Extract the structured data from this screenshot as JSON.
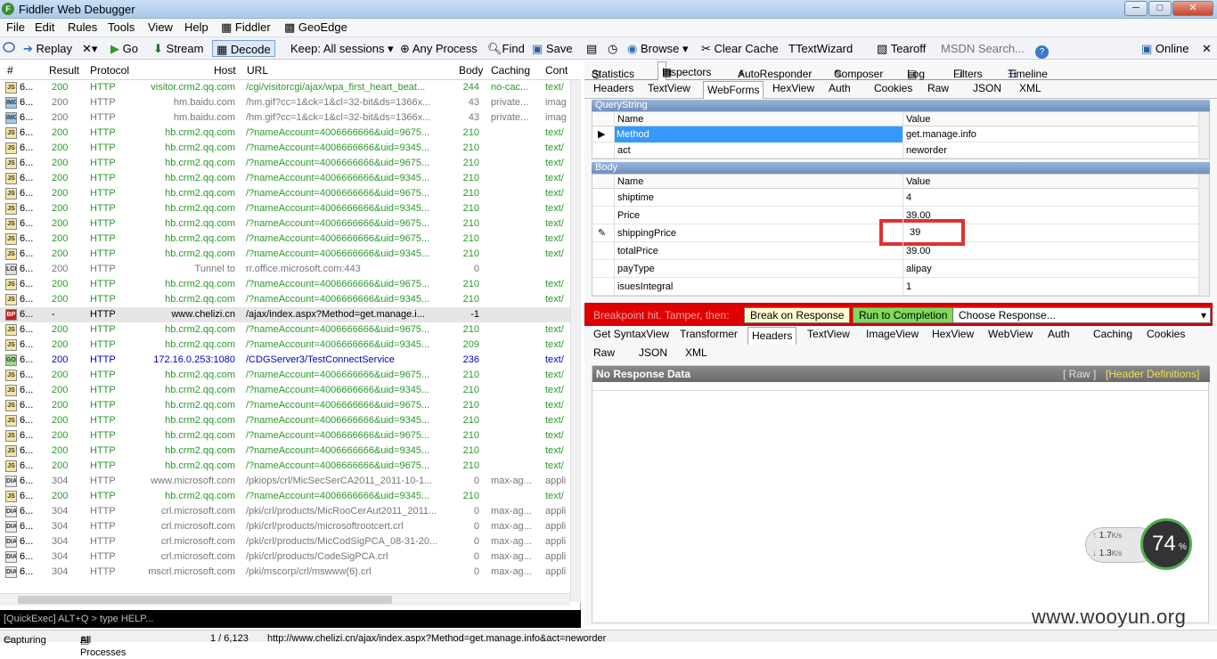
{
  "window": {
    "title": "Fiddler Web Debugger",
    "minimize": "─",
    "maximize": "□",
    "close": "✕"
  },
  "menu": [
    "File",
    "Edit",
    "Rules",
    "Tools",
    "View",
    "Help",
    "Fiddler",
    "GeoEdge"
  ],
  "toolbar": {
    "replay": "Replay",
    "go": "Go",
    "stream": "Stream",
    "decode": "Decode",
    "keep": "Keep: All sessions",
    "process": "Any Process",
    "find": "Find",
    "save": "Save",
    "browse": "Browse",
    "clearcache": "Clear Cache",
    "textwizard": "TextWizard",
    "tearoff": "Tearoff",
    "msdn_placeholder": "MSDN Search...",
    "online": "Online"
  },
  "grid": {
    "columns": [
      "#",
      "Result",
      "Protocol",
      "Host",
      "URL",
      "Body",
      "Caching",
      "Cont"
    ],
    "rows": [
      {
        "id": "6...",
        "result": "200",
        "proto": "HTTP",
        "host": "visitor.crm2.qq.com",
        "url": "/cgi/visitorcgi/ajax/wpa_first_heart_beat...",
        "body": "244",
        "cache": "no-cac...",
        "type": "text/",
        "color": "g",
        "icon": "JS"
      },
      {
        "id": "6...",
        "result": "200",
        "proto": "HTTP",
        "host": "hm.baidu.com",
        "url": "/hm.gif?cc=1&ck=1&cl=32-bit&ds=1366x...",
        "body": "43",
        "cache": "private...",
        "type": "imag",
        "color": "gr",
        "icon": "IMG"
      },
      {
        "id": "6...",
        "result": "200",
        "proto": "HTTP",
        "host": "hm.baidu.com",
        "url": "/hm.gif?cc=1&ck=1&cl=32-bit&ds=1366x...",
        "body": "43",
        "cache": "private...",
        "type": "imag",
        "color": "gr",
        "icon": "IMG"
      },
      {
        "id": "6...",
        "result": "200",
        "proto": "HTTP",
        "host": "hb.crm2.qq.com",
        "url": "/?nameAccount=4006666666&uid=9675...",
        "body": "210",
        "cache": "",
        "type": "text/",
        "color": "g",
        "icon": "JS"
      },
      {
        "id": "6...",
        "result": "200",
        "proto": "HTTP",
        "host": "hb.crm2.qq.com",
        "url": "/?nameAccount=4006666666&uid=9345...",
        "body": "210",
        "cache": "",
        "type": "text/",
        "color": "g",
        "icon": "JS"
      },
      {
        "id": "6...",
        "result": "200",
        "proto": "HTTP",
        "host": "hb.crm2.qq.com",
        "url": "/?nameAccount=4006666666&uid=9675...",
        "body": "210",
        "cache": "",
        "type": "text/",
        "color": "g",
        "icon": "JS"
      },
      {
        "id": "6...",
        "result": "200",
        "proto": "HTTP",
        "host": "hb.crm2.qq.com",
        "url": "/?nameAccount=4006666666&uid=9345...",
        "body": "210",
        "cache": "",
        "type": "text/",
        "color": "g",
        "icon": "JS"
      },
      {
        "id": "6...",
        "result": "200",
        "proto": "HTTP",
        "host": "hb.crm2.qq.com",
        "url": "/?nameAccount=4006666666&uid=9675...",
        "body": "210",
        "cache": "",
        "type": "text/",
        "color": "g",
        "icon": "JS"
      },
      {
        "id": "6...",
        "result": "200",
        "proto": "HTTP",
        "host": "hb.crm2.qq.com",
        "url": "/?nameAccount=4006666666&uid=9345...",
        "body": "210",
        "cache": "",
        "type": "text/",
        "color": "g",
        "icon": "JS"
      },
      {
        "id": "6...",
        "result": "200",
        "proto": "HTTP",
        "host": "hb.crm2.qq.com",
        "url": "/?nameAccount=4006666666&uid=9675...",
        "body": "210",
        "cache": "",
        "type": "text/",
        "color": "g",
        "icon": "JS"
      },
      {
        "id": "6...",
        "result": "200",
        "proto": "HTTP",
        "host": "hb.crm2.qq.com",
        "url": "/?nameAccount=4006666666&uid=9675...",
        "body": "210",
        "cache": "",
        "type": "text/",
        "color": "g",
        "icon": "JS"
      },
      {
        "id": "6...",
        "result": "200",
        "proto": "HTTP",
        "host": "hb.crm2.qq.com",
        "url": "/?nameAccount=4006666666&uid=9345...",
        "body": "210",
        "cache": "",
        "type": "text/",
        "color": "g",
        "icon": "JS"
      },
      {
        "id": "6...",
        "result": "200",
        "proto": "HTTP",
        "host": "Tunnel to",
        "url": "rr.office.microsoft.com:443",
        "body": "0",
        "cache": "",
        "type": "",
        "color": "gr",
        "icon": "LCK"
      },
      {
        "id": "6...",
        "result": "200",
        "proto": "HTTP",
        "host": "hb.crm2.qq.com",
        "url": "/?nameAccount=4006666666&uid=9675...",
        "body": "210",
        "cache": "",
        "type": "text/",
        "color": "g",
        "icon": "JS"
      },
      {
        "id": "6...",
        "result": "200",
        "proto": "HTTP",
        "host": "hb.crm2.qq.com",
        "url": "/?nameAccount=4006666666&uid=9345...",
        "body": "210",
        "cache": "",
        "type": "text/",
        "color": "g",
        "icon": "JS"
      },
      {
        "id": "6...",
        "result": "-",
        "proto": "HTTP",
        "host": "www.chelizi.cn",
        "url": "/ajax/index.aspx?Method=get.manage.i...",
        "body": "-1",
        "cache": "",
        "type": "",
        "color": "bk",
        "icon": "BP",
        "selected": true
      },
      {
        "id": "6...",
        "result": "200",
        "proto": "HTTP",
        "host": "hb.crm2.qq.com",
        "url": "/?nameAccount=4006666666&uid=9675...",
        "body": "210",
        "cache": "",
        "type": "text/",
        "color": "g",
        "icon": "JS"
      },
      {
        "id": "6...",
        "result": "200",
        "proto": "HTTP",
        "host": "hb.crm2.qq.com",
        "url": "/?nameAccount=4006666666&uid=9345...",
        "body": "209",
        "cache": "",
        "type": "text/",
        "color": "g",
        "icon": "JS"
      },
      {
        "id": "6...",
        "result": "200",
        "proto": "HTTP",
        "host": "172.16.0.253:1080",
        "url": "/CDGServer3/TestConnectService",
        "body": "236",
        "cache": "",
        "type": "text/",
        "color": "bl",
        "icon": "GO"
      },
      {
        "id": "6...",
        "result": "200",
        "proto": "HTTP",
        "host": "hb.crm2.qq.com",
        "url": "/?nameAccount=4006666666&uid=9675...",
        "body": "210",
        "cache": "",
        "type": "text/",
        "color": "g",
        "icon": "JS"
      },
      {
        "id": "6...",
        "result": "200",
        "proto": "HTTP",
        "host": "hb.crm2.qq.com",
        "url": "/?nameAccount=4006666666&uid=9345...",
        "body": "210",
        "cache": "",
        "type": "text/",
        "color": "g",
        "icon": "JS"
      },
      {
        "id": "6...",
        "result": "200",
        "proto": "HTTP",
        "host": "hb.crm2.qq.com",
        "url": "/?nameAccount=4006666666&uid=9675...",
        "body": "210",
        "cache": "",
        "type": "text/",
        "color": "g",
        "icon": "JS"
      },
      {
        "id": "6...",
        "result": "200",
        "proto": "HTTP",
        "host": "hb.crm2.qq.com",
        "url": "/?nameAccount=4006666666&uid=9345...",
        "body": "210",
        "cache": "",
        "type": "text/",
        "color": "g",
        "icon": "JS"
      },
      {
        "id": "6...",
        "result": "200",
        "proto": "HTTP",
        "host": "hb.crm2.qq.com",
        "url": "/?nameAccount=4006666666&uid=9675...",
        "body": "210",
        "cache": "",
        "type": "text/",
        "color": "g",
        "icon": "JS"
      },
      {
        "id": "6...",
        "result": "200",
        "proto": "HTTP",
        "host": "hb.crm2.qq.com",
        "url": "/?nameAccount=4006666666&uid=9345...",
        "body": "210",
        "cache": "",
        "type": "text/",
        "color": "g",
        "icon": "JS"
      },
      {
        "id": "6...",
        "result": "200",
        "proto": "HTTP",
        "host": "hb.crm2.qq.com",
        "url": "/?nameAccount=4006666666&uid=9675...",
        "body": "210",
        "cache": "",
        "type": "text/",
        "color": "g",
        "icon": "JS"
      },
      {
        "id": "6...",
        "result": "304",
        "proto": "HTTP",
        "host": "www.microsoft.com",
        "url": "/pkiops/crl/MicSecSerCA2011_2011-10-1...",
        "body": "0",
        "cache": "max-ag...",
        "type": "appli",
        "color": "gr",
        "icon": "DIA"
      },
      {
        "id": "6...",
        "result": "200",
        "proto": "HTTP",
        "host": "hb.crm2.qq.com",
        "url": "/?nameAccount=4006666666&uid=9345...",
        "body": "210",
        "cache": "",
        "type": "text/",
        "color": "g",
        "icon": "JS"
      },
      {
        "id": "6...",
        "result": "304",
        "proto": "HTTP",
        "host": "crl.microsoft.com",
        "url": "/pki/crl/products/MicRooCerAut2011_2011...",
        "body": "0",
        "cache": "max-ag...",
        "type": "appli",
        "color": "gr",
        "icon": "DIA"
      },
      {
        "id": "6...",
        "result": "304",
        "proto": "HTTP",
        "host": "crl.microsoft.com",
        "url": "/pki/crl/products/microsoftrootcert.crl",
        "body": "0",
        "cache": "max-ag...",
        "type": "appli",
        "color": "gr",
        "icon": "DIA"
      },
      {
        "id": "6...",
        "result": "304",
        "proto": "HTTP",
        "host": "crl.microsoft.com",
        "url": "/pki/crl/products/MicCodSigPCA_08-31-20...",
        "body": "0",
        "cache": "max-ag...",
        "type": "appli",
        "color": "gr",
        "icon": "DIA"
      },
      {
        "id": "6...",
        "result": "304",
        "proto": "HTTP",
        "host": "crl.microsoft.com",
        "url": "/pki/crl/products/CodeSigPCA.crl",
        "body": "0",
        "cache": "max-ag...",
        "type": "appli",
        "color": "gr",
        "icon": "DIA"
      },
      {
        "id": "6...",
        "result": "304",
        "proto": "HTTP",
        "host": "mscrl.microsoft.com",
        "url": "/pki/mscorp/crl/mswww(6).crl",
        "body": "0",
        "cache": "max-ag...",
        "type": "appli",
        "color": "gr",
        "icon": "DIA"
      }
    ]
  },
  "quickexec": "[QuickExec] ALT+Q > type HELP...",
  "status": {
    "capture": "Capturing",
    "processes": "All Processes",
    "count": "1 / 6,123",
    "url": "http://www.chelizi.cn/ajax/index.aspx?Method=get.manage.info&act=neworder"
  },
  "tabsA": [
    "Statistics",
    "Inspectors",
    "AutoResponder",
    "Composer",
    "Log",
    "Filters",
    "Timeline"
  ],
  "tabsB": [
    "Headers",
    "TextView",
    "WebForms",
    "HexView",
    "Auth",
    "Cookies",
    "Raw",
    "JSON",
    "XML"
  ],
  "querystring": {
    "title": "QueryString",
    "name_col": "Name",
    "value_col": "Value",
    "rows": [
      {
        "name": "Method",
        "value": "get.manage.info"
      },
      {
        "name": "act",
        "value": "neworder"
      }
    ]
  },
  "body": {
    "title": "Body",
    "name_col": "Name",
    "value_col": "Value",
    "rows": [
      {
        "name": "shiptime",
        "value": "4"
      },
      {
        "name": "Price",
        "value": "39.00"
      },
      {
        "name": "shippingPrice",
        "value": "39"
      },
      {
        "name": "totalPrice",
        "value": "39.00"
      },
      {
        "name": "payType",
        "value": "alipay"
      },
      {
        "name": "isuesIntegral",
        "value": "1"
      }
    ]
  },
  "breakpoint": {
    "label": "Breakpoint hit. Tamper, then:",
    "break_btn": "Break on Response",
    "run_btn": "Run to Completion",
    "choose": "Choose Response..."
  },
  "tabsC": [
    "Get SyntaxView",
    "Transformer",
    "Headers",
    "TextView",
    "ImageView",
    "HexView",
    "WebView",
    "Auth",
    "Caching",
    "Cookies"
  ],
  "tabsD": [
    "Raw",
    "JSON",
    "XML"
  ],
  "response": {
    "title": "No Response Data",
    "raw": "[ Raw ]",
    "hdrdefs": "[Header Definitions]"
  },
  "network": {
    "up": "1.7",
    "down": "1.3",
    "unit": "K/s",
    "percent": "74",
    "pct_sign": "%"
  },
  "watermark": "www.wooyun.org"
}
